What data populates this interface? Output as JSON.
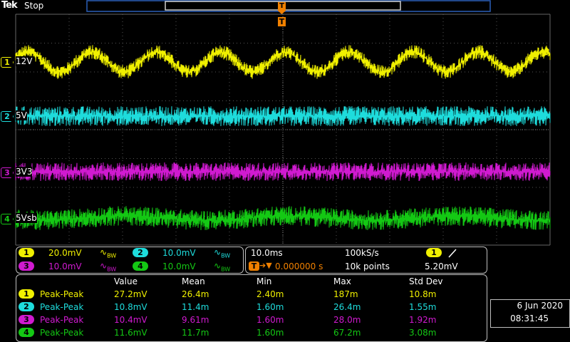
{
  "header": {
    "brand": "Tek",
    "status": "Stop",
    "trigger_marker": "T"
  },
  "channels": [
    {
      "num": "1",
      "name": "12V",
      "color": "#f0f000"
    },
    {
      "num": "2",
      "name": "5V",
      "color": "#1edcdc"
    },
    {
      "num": "3",
      "name": "3V3",
      "color": "#d01ad0"
    },
    {
      "num": "4",
      "name": "5Vsb",
      "color": "#14c814"
    }
  ],
  "vertical_settings": [
    {
      "num": "1",
      "scale": "20.0mV",
      "bw": "BW",
      "color": "#f0f000"
    },
    {
      "num": "2",
      "scale": "10.0mV",
      "bw": "BW",
      "color": "#1edcdc"
    },
    {
      "num": "3",
      "scale": "10.0mV",
      "bw": "BW",
      "color": "#d01ad0"
    },
    {
      "num": "4",
      "scale": "10.0mV",
      "bw": "BW",
      "color": "#14c814"
    }
  ],
  "horizontal": {
    "time_div": "10.0ms",
    "sample_rate": "100kS/s",
    "trigger_pos": "0.000000 s",
    "record_length": "10k points",
    "trigger_source": "1",
    "trigger_slope_icon": "rising-edge",
    "trigger_level": "5.20mV"
  },
  "measurements": {
    "headers": [
      "Value",
      "Mean",
      "Min",
      "Max",
      "Std Dev"
    ],
    "rows": [
      {
        "ch": "1",
        "type": "Peak-Peak",
        "value": "27.2mV",
        "mean": "26.4m",
        "min": "2.40m",
        "max": "187m",
        "std": "10.8m",
        "color": "#f0f000"
      },
      {
        "ch": "2",
        "type": "Peak-Peak",
        "value": "10.8mV",
        "mean": "11.4m",
        "min": "1.60m",
        "max": "26.4m",
        "std": "1.55m",
        "color": "#1edcdc"
      },
      {
        "ch": "3",
        "type": "Peak-Peak",
        "value": "10.4mV",
        "mean": "9.61m",
        "min": "1.60m",
        "max": "28.0m",
        "std": "1.92m",
        "color": "#d01ad0"
      },
      {
        "ch": "4",
        "type": "Peak-Peak",
        "value": "11.6mV",
        "mean": "11.7m",
        "min": "1.60m",
        "max": "67.2m",
        "std": "3.08m",
        "color": "#14c814"
      }
    ]
  },
  "datetime": {
    "date": "6 Jun  2020",
    "time": "08:31:45"
  }
}
